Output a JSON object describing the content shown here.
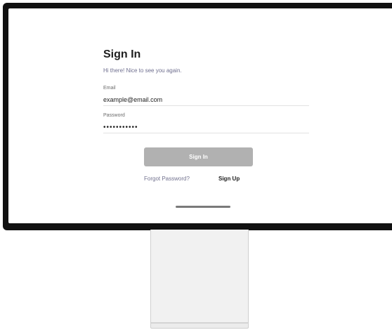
{
  "signin": {
    "title": "Sign In",
    "subtitle": "Hi there! Nice to see you again.",
    "email_label": "Email",
    "email_value": "example@email.com",
    "password_label": "Password",
    "password_value": "•••••••••••",
    "button_label": "Sign In",
    "forgot_label": "Forgot Password?",
    "signup_label": "Sign Up"
  },
  "colors": {
    "button_bg": "#b1b1b1",
    "link_muted": "#72728f",
    "monitor_bezel": "#111111"
  }
}
